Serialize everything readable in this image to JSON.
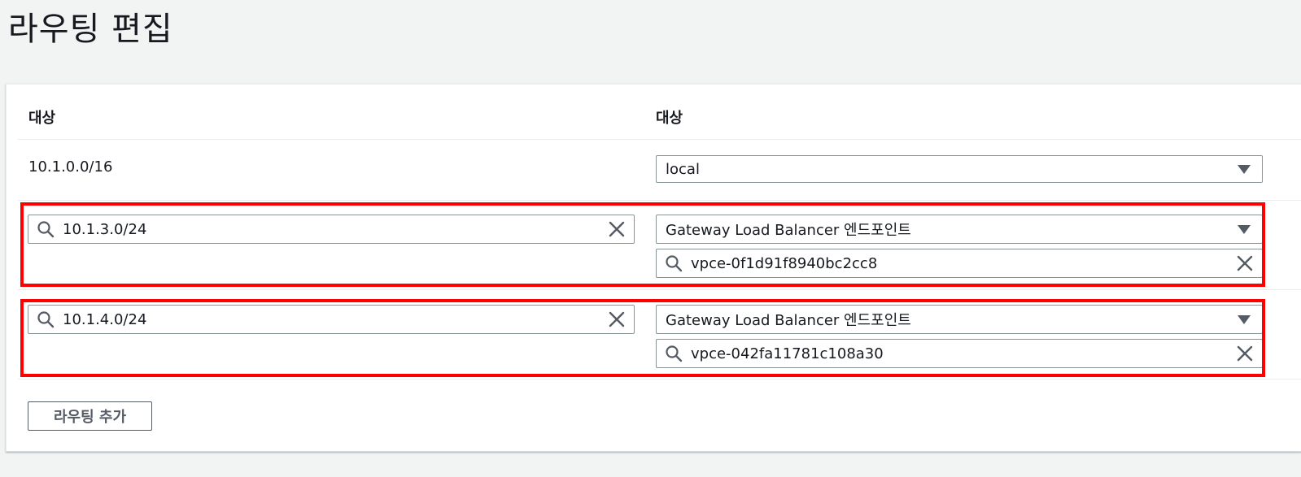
{
  "page": {
    "title": "라우팅 편집"
  },
  "table": {
    "col_destination": "대상",
    "col_target": "대상"
  },
  "routes": [
    {
      "destination": "10.1.0.0/16",
      "target_type": "local"
    },
    {
      "destination": "10.1.3.0/24",
      "target_type": "Gateway Load Balancer 엔드포인트",
      "target_id": "vpce-0f1d91f8940bc2cc8"
    },
    {
      "destination": "10.1.4.0/24",
      "target_type": "Gateway Load Balancer 엔드포인트",
      "target_id": "vpce-042fa11781c108a30"
    }
  ],
  "actions": {
    "add_route_label": "라우팅 추가"
  },
  "icons": {
    "search": "search-icon",
    "clear": "close-icon",
    "dropdown": "caret-down-icon"
  },
  "colors": {
    "highlight": "#ff0000",
    "background": "#f2f3f3",
    "panel": "#ffffff",
    "border": "#879596"
  }
}
